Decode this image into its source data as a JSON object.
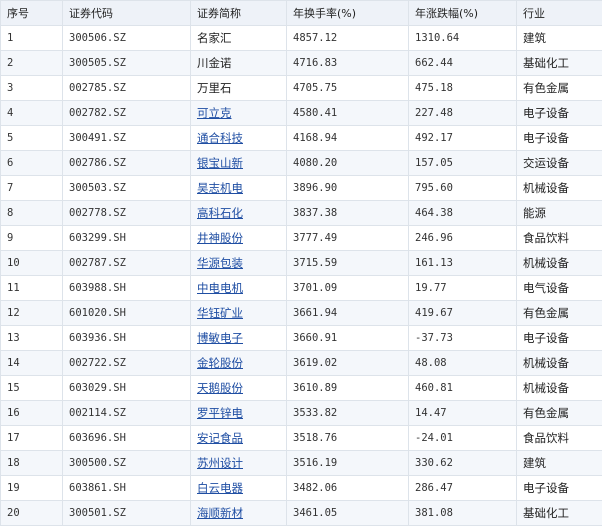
{
  "headers": [
    "序号",
    "证券代码",
    "证券简称",
    "年换手率(%)",
    "年涨跌幅(%)",
    "行业"
  ],
  "rows": [
    {
      "idx": "1",
      "code": "300506.SZ",
      "name": "名家汇",
      "link": false,
      "turnover": "4857.12",
      "change": "1310.64",
      "industry": "建筑"
    },
    {
      "idx": "2",
      "code": "300505.SZ",
      "name": "川金诺",
      "link": false,
      "turnover": "4716.83",
      "change": "662.44",
      "industry": "基础化工"
    },
    {
      "idx": "3",
      "code": "002785.SZ",
      "name": "万里石",
      "link": false,
      "turnover": "4705.75",
      "change": "475.18",
      "industry": "有色金属"
    },
    {
      "idx": "4",
      "code": "002782.SZ",
      "name": "可立克",
      "link": true,
      "turnover": "4580.41",
      "change": "227.48",
      "industry": "电子设备"
    },
    {
      "idx": "5",
      "code": "300491.SZ",
      "name": "通合科技",
      "link": true,
      "turnover": "4168.94",
      "change": "492.17",
      "industry": "电子设备"
    },
    {
      "idx": "6",
      "code": "002786.SZ",
      "name": "银宝山新",
      "link": true,
      "turnover": "4080.20",
      "change": "157.05",
      "industry": "交运设备"
    },
    {
      "idx": "7",
      "code": "300503.SZ",
      "name": "昊志机电",
      "link": true,
      "turnover": "3896.90",
      "change": "795.60",
      "industry": "机械设备"
    },
    {
      "idx": "8",
      "code": "002778.SZ",
      "name": "高科石化",
      "link": true,
      "turnover": "3837.38",
      "change": "464.38",
      "industry": "能源"
    },
    {
      "idx": "9",
      "code": "603299.SH",
      "name": "井神股份",
      "link": true,
      "turnover": "3777.49",
      "change": "246.96",
      "industry": "食品饮料"
    },
    {
      "idx": "10",
      "code": "002787.SZ",
      "name": "华源包装",
      "link": true,
      "turnover": "3715.59",
      "change": "161.13",
      "industry": "机械设备"
    },
    {
      "idx": "11",
      "code": "603988.SH",
      "name": "中电电机",
      "link": true,
      "turnover": "3701.09",
      "change": "19.77",
      "industry": "电气设备"
    },
    {
      "idx": "12",
      "code": "601020.SH",
      "name": "华钰矿业",
      "link": true,
      "turnover": "3661.94",
      "change": "419.67",
      "industry": "有色金属"
    },
    {
      "idx": "13",
      "code": "603936.SH",
      "name": "博敏电子",
      "link": true,
      "turnover": "3660.91",
      "change": "-37.73",
      "industry": "电子设备"
    },
    {
      "idx": "14",
      "code": "002722.SZ",
      "name": "金轮股份",
      "link": true,
      "turnover": "3619.02",
      "change": "48.08",
      "industry": "机械设备"
    },
    {
      "idx": "15",
      "code": "603029.SH",
      "name": "天鹅股份",
      "link": true,
      "turnover": "3610.89",
      "change": "460.81",
      "industry": "机械设备"
    },
    {
      "idx": "16",
      "code": "002114.SZ",
      "name": "罗平锌电",
      "link": true,
      "turnover": "3533.82",
      "change": "14.47",
      "industry": "有色金属"
    },
    {
      "idx": "17",
      "code": "603696.SH",
      "name": "安记食品",
      "link": true,
      "turnover": "3518.76",
      "change": "-24.01",
      "industry": "食品饮料"
    },
    {
      "idx": "18",
      "code": "300500.SZ",
      "name": "苏州设计",
      "link": true,
      "turnover": "3516.19",
      "change": "330.62",
      "industry": "建筑"
    },
    {
      "idx": "19",
      "code": "603861.SH",
      "name": "白云电器",
      "link": true,
      "turnover": "3482.06",
      "change": "286.47",
      "industry": "电子设备"
    },
    {
      "idx": "20",
      "code": "300501.SZ",
      "name": "海顺新材",
      "link": true,
      "turnover": "3461.05",
      "change": "381.08",
      "industry": "基础化工"
    }
  ]
}
